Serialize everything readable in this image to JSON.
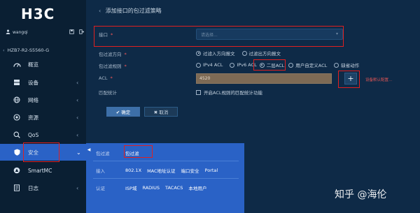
{
  "brand": {
    "logo": "H3C"
  },
  "user": {
    "name": "wangqi",
    "icons": [
      "user-icon",
      "save-icon",
      "logout-icon"
    ]
  },
  "device": {
    "name": "HZB7-R2-S5560-G"
  },
  "sidebar": {
    "items": [
      {
        "label": "概览",
        "icon": "dashboard-icon",
        "arrow": ""
      },
      {
        "label": "设备",
        "icon": "device-icon",
        "arrow": "‹"
      },
      {
        "label": "网络",
        "icon": "globe-icon",
        "arrow": "‹"
      },
      {
        "label": "资源",
        "icon": "resource-icon",
        "arrow": "‹"
      },
      {
        "label": "QoS",
        "icon": "qos-icon",
        "arrow": "‹"
      },
      {
        "label": "安全",
        "icon": "shield-icon",
        "arrow": "⌄"
      },
      {
        "label": "SmartMC",
        "icon": "smartmc-icon",
        "arrow": ""
      },
      {
        "label": "日志",
        "icon": "log-icon",
        "arrow": "‹"
      }
    ]
  },
  "page": {
    "back": "‹",
    "title": "添加接口的包过滤策略"
  },
  "form": {
    "interface": {
      "label": "接口",
      "required": "*",
      "placeholder": "请选择..."
    },
    "direction": {
      "label": "包过滤方向",
      "required": "*",
      "options": [
        "过滤入方向报文",
        "过滤出方向报文"
      ]
    },
    "rule": {
      "label": "包过滤规则",
      "required": "*",
      "options": [
        "IPv4 ACL",
        "IPv6 ACL",
        "二层ACL",
        "用户自定义ACL",
        "缺省动作"
      ]
    },
    "acl": {
      "label": "ACL",
      "required": "*",
      "value": "4520",
      "add": "+",
      "hint": "设备默认配置..."
    },
    "stats": {
      "label": "匹配统计",
      "checkbox_text": "开启ACL规则的匹配统计功能"
    },
    "buttons": {
      "ok": "✔ 确定",
      "cancel": "✖ 取消"
    }
  },
  "popup": {
    "collapse": "◀",
    "rows": [
      {
        "label": "包过滤",
        "items": [
          "包过滤"
        ]
      },
      {
        "label": "接入",
        "items": [
          "802.1X",
          "MAC地址认证",
          "端口安全",
          "Portal"
        ]
      },
      {
        "label": "认证",
        "items": [
          "ISP域",
          "RADIUS",
          "TACACS",
          "本地用户"
        ]
      }
    ]
  },
  "watermark": "知乎 @海伦",
  "colors": {
    "sidebar_bg": "#0a1f33",
    "content_bg": "#0e2a47",
    "active": "#2a62c6",
    "highlight": "#e02020"
  }
}
